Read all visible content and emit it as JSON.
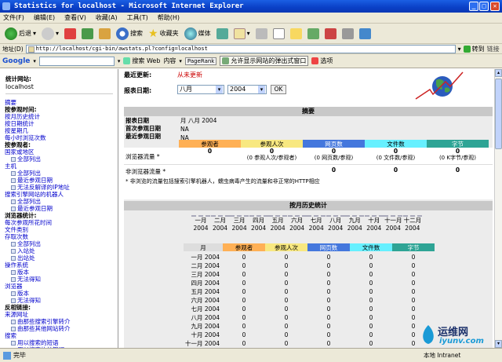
{
  "window": {
    "title": "Statistics for localhost - Microsoft Internet Explorer"
  },
  "menu": [
    "文件(F)",
    "编辑(E)",
    "查看(V)",
    "收藏(A)",
    "工具(T)",
    "帮助(H)"
  ],
  "toolbar": {
    "back": "后退",
    "search": "搜索",
    "favorites": "收藏夹",
    "media": "媒体"
  },
  "address": {
    "label": "地址(D)",
    "url": "http://localhost/cgi-bin/awstats.pl?config=localhost",
    "go": "转到",
    "links": "链接"
  },
  "google": {
    "label": "Google",
    "search_web": "搜索 Web",
    "content": "内容",
    "pagerank": "PageRank",
    "popup_text": "允许显示网站的弹出式窗口",
    "options": "选项"
  },
  "sidebar": {
    "site_label": "统计网站:",
    "site_value": "localhost",
    "items": [
      {
        "t": "link",
        "v": "摘要"
      },
      {
        "t": "hdr",
        "v": "按参观时间:"
      },
      {
        "t": "link",
        "v": "按月历史统计"
      },
      {
        "t": "link",
        "v": "按日期统计"
      },
      {
        "t": "link",
        "v": "按星期几"
      },
      {
        "t": "link",
        "v": "每小时浏览次数"
      },
      {
        "t": "hdr",
        "v": "按参观者:"
      },
      {
        "t": "link",
        "v": "国家或地区"
      },
      {
        "t": "sub",
        "v": "全部列出"
      },
      {
        "t": "link",
        "v": "主机"
      },
      {
        "t": "sub",
        "v": "全部列出"
      },
      {
        "t": "sub",
        "v": "最近参观日期"
      },
      {
        "t": "sub",
        "v": "无法反解译的IP地址"
      },
      {
        "t": "link",
        "v": "搜索引擎网站的机器人"
      },
      {
        "t": "sub",
        "v": "全部列出"
      },
      {
        "t": "sub",
        "v": "最近参观日期"
      },
      {
        "t": "hdr",
        "v": "浏览器统计:"
      },
      {
        "t": "link",
        "v": "每次参观所花时间"
      },
      {
        "t": "link",
        "v": "文件类别"
      },
      {
        "t": "link",
        "v": "存取次数"
      },
      {
        "t": "sub",
        "v": "全部列出"
      },
      {
        "t": "sub",
        "v": "入站处"
      },
      {
        "t": "sub",
        "v": "出站处"
      },
      {
        "t": "link",
        "v": "操作系统"
      },
      {
        "t": "sub",
        "v": "版本"
      },
      {
        "t": "sub",
        "v": "无法得知"
      },
      {
        "t": "link",
        "v": "浏览器"
      },
      {
        "t": "sub",
        "v": "版本"
      },
      {
        "t": "sub",
        "v": "无法得知"
      },
      {
        "t": "hdr",
        "v": "反相链接:"
      },
      {
        "t": "link",
        "v": "来源网址"
      },
      {
        "t": "sub",
        "v": "由那些搜索引擎转介"
      },
      {
        "t": "sub",
        "v": "由那些其他网站转介"
      },
      {
        "t": "link",
        "v": "搜索"
      },
      {
        "t": "sub",
        "v": "用以搜索的短语"
      },
      {
        "t": "sub",
        "v": "用以搜索的关键词"
      }
    ]
  },
  "main": {
    "last_update_label": "最近更新:",
    "last_update_value": "从未更新",
    "period_label": "报表日期:",
    "month_value": "八月",
    "year_value": "2004",
    "ok": "OK",
    "summary": {
      "title": "摘要",
      "rows": [
        {
          "label": "报表日期",
          "value": "月 八月 2004"
        },
        {
          "label": "首次参观日期",
          "value": "NA"
        },
        {
          "label": "最近参观日期",
          "value": "NA"
        }
      ],
      "cols": [
        "参观者",
        "参观人次",
        "网页数",
        "文件数",
        "字节"
      ],
      "col_colors": [
        "#ffb055",
        "#f8e880",
        "#4477dd",
        "#66f0ff",
        "#2ea495"
      ],
      "viewed_label": "浏览器流量 *",
      "viewed": [
        "0",
        "0",
        "0",
        "0",
        "0"
      ],
      "viewed_sub": [
        "",
        "(0 参观人次/参观者)",
        "(0 网页数/参观)",
        "(0 文件数/参观)",
        "(0 K字节/参观)"
      ],
      "notviewed_label": "非浏览器流量 *",
      "notviewed": [
        "",
        "",
        "0",
        "0",
        "0"
      ],
      "footnote": "* 非浏览的流量包括搜索引擎机器人，蠕虫病毒产生的流量和非正常的HTTP相应"
    },
    "history": {
      "title": "按月历史统计",
      "months": [
        "一月",
        "二月",
        "三月",
        "四月",
        "五月",
        "六月",
        "七月",
        "八月",
        "九月",
        "十月",
        "十一月",
        "十二月"
      ],
      "year": "2004",
      "cols": [
        "月",
        "参观者",
        "参观人次",
        "网页数",
        "文件数",
        "字节"
      ],
      "rows": [
        {
          "m": "一月 2004",
          "v": [
            "0",
            "0",
            "0",
            "0",
            "0"
          ]
        },
        {
          "m": "二月 2004",
          "v": [
            "0",
            "0",
            "0",
            "0",
            "0"
          ]
        },
        {
          "m": "三月 2004",
          "v": [
            "0",
            "0",
            "0",
            "0",
            "0"
          ]
        },
        {
          "m": "四月 2004",
          "v": [
            "0",
            "0",
            "0",
            "0",
            "0"
          ]
        },
        {
          "m": "五月 2004",
          "v": [
            "0",
            "0",
            "0",
            "0",
            "0"
          ]
        },
        {
          "m": "六月 2004",
          "v": [
            "0",
            "0",
            "0",
            "0",
            "0"
          ]
        },
        {
          "m": "七月 2004",
          "v": [
            "0",
            "0",
            "0",
            "0",
            "0"
          ]
        },
        {
          "m": "八月 2004",
          "v": [
            "0",
            "0",
            "0",
            "0",
            "0"
          ]
        },
        {
          "m": "九月 2004",
          "v": [
            "0",
            "0",
            "0",
            "0",
            "0"
          ]
        },
        {
          "m": "十月 2004",
          "v": [
            "0",
            "0",
            "0",
            "0",
            "0"
          ]
        },
        {
          "m": "十一月 2004",
          "v": [
            "0",
            "0",
            "0",
            "0",
            "0"
          ]
        }
      ]
    }
  },
  "status": {
    "text": "完毕",
    "zone": "本地 Intranet"
  },
  "watermark": {
    "line1": "运维网",
    "line2": "iyunv.com"
  }
}
